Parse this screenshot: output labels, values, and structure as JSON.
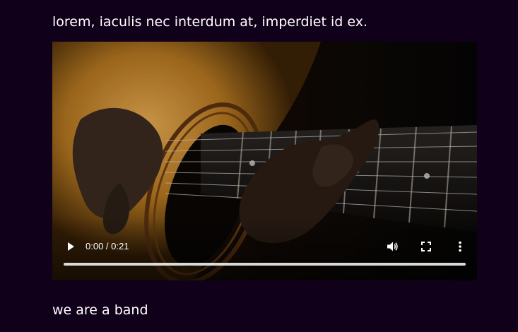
{
  "content": {
    "intro_paragraph_end": "lorem, iaculis nec interdum at, imperdiet id ex.",
    "band_text": "we are a band"
  },
  "video": {
    "time_display": "0:00 / 0:21",
    "progress_fraction": 0,
    "icons": {
      "play": "play-icon",
      "volume": "volume-icon",
      "fullscreen": "fullscreen-icon",
      "menu": "more-vertical-icon"
    }
  },
  "colors": {
    "background": "#10001a",
    "text": "#ffffff"
  }
}
